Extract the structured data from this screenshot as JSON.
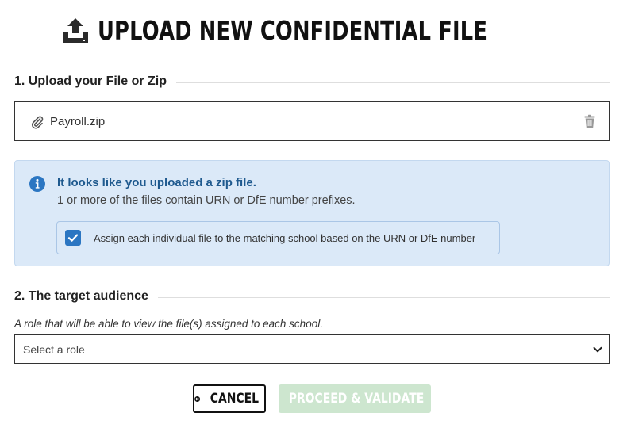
{
  "header": {
    "title": "UPLOAD NEW CONFIDENTIAL FILE",
    "icon": "upload-tray-icon"
  },
  "upload_section": {
    "heading": "1. Upload your File or Zip",
    "file": {
      "name": "Payroll.zip",
      "icon": "paperclip-icon",
      "delete_icon": "trash-icon"
    }
  },
  "zip_notice": {
    "icon": "info-circle-icon",
    "heading": "It looks like you uploaded a zip file.",
    "message": "1 or more of the files contain URN or DfE number prefixes.",
    "assign_checkbox": {
      "checked": true,
      "label": "Assign each individual file to the matching school based on the URN or DfE number"
    }
  },
  "audience_section": {
    "heading": "2. The target audience",
    "hint": "A role that will be able to view the file(s) assigned to each school.",
    "role_select": {
      "placeholder": "Select a role"
    }
  },
  "actions": {
    "cancel_label": "CANCEL",
    "proceed_label": "PROCEED & VALIDATE",
    "proceed_enabled": false
  },
  "colors": {
    "info_background": "#dbe9f8",
    "info_heading": "#1f5a8f",
    "checkbox": "#2b76c2",
    "proceed_disabled": "#cde6cf"
  }
}
